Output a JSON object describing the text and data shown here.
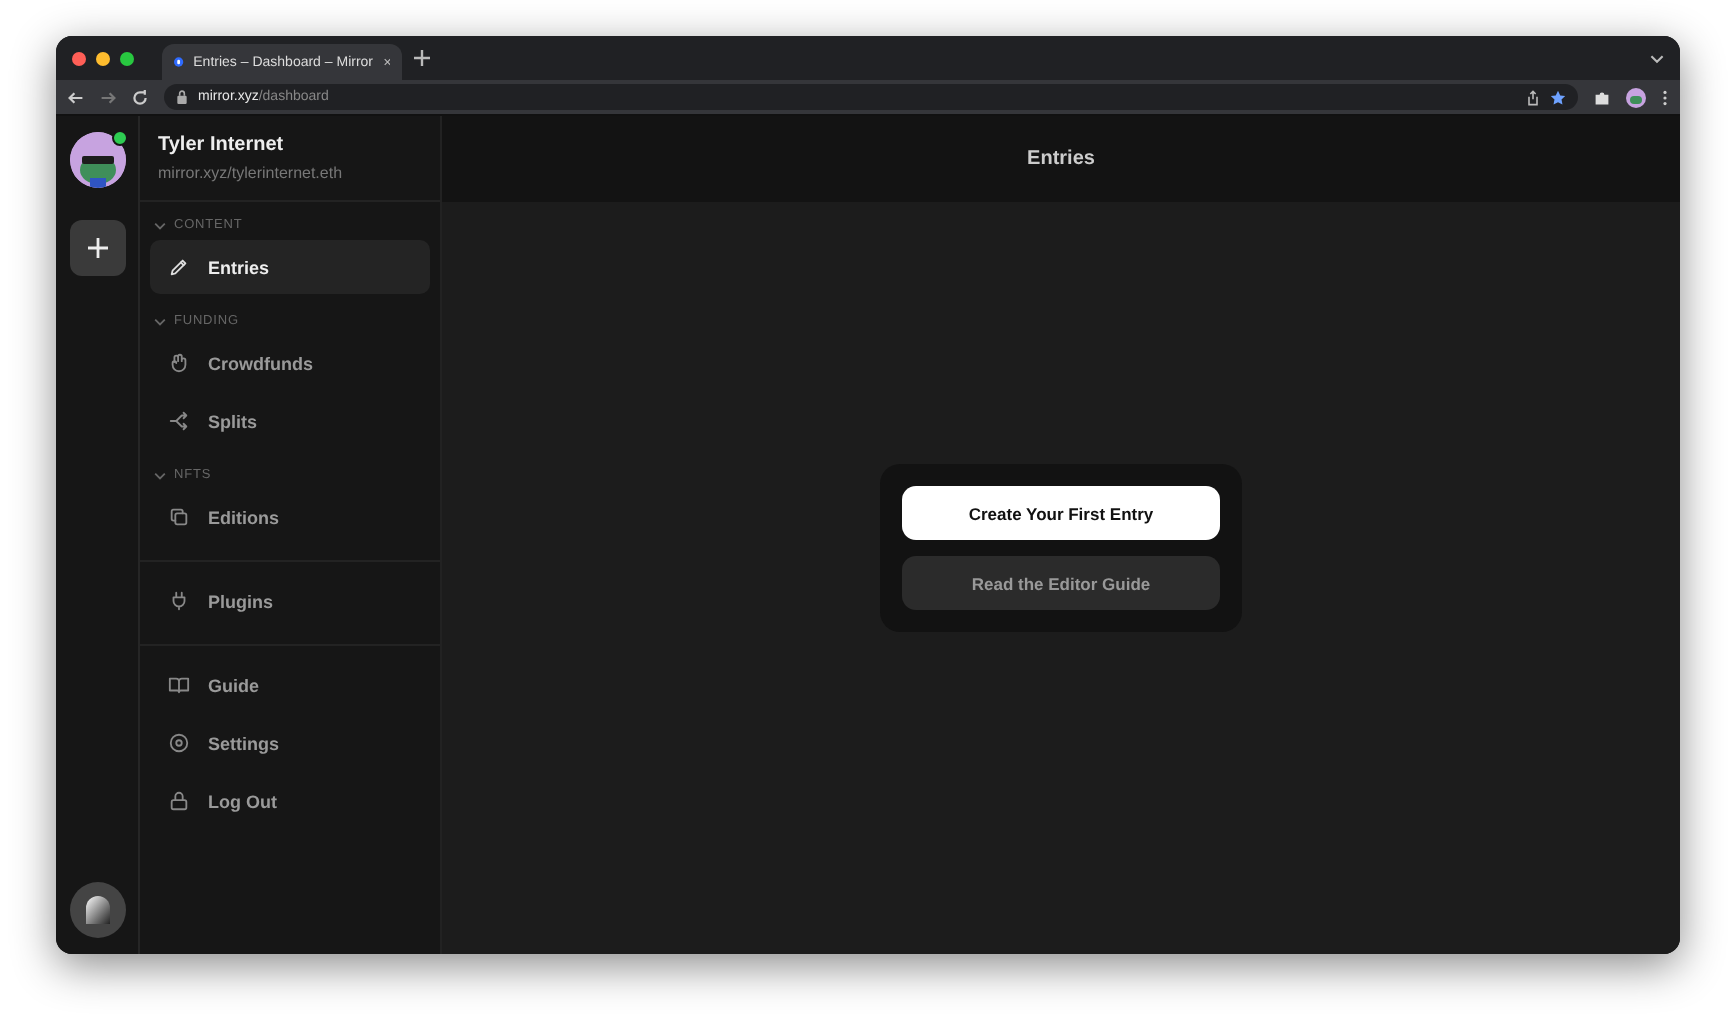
{
  "browser": {
    "tab_title": "Entries – Dashboard – Mirror",
    "url_host": "mirror.xyz",
    "url_path": "/dashboard",
    "bookmarked": true
  },
  "profile": {
    "name": "Tyler Internet",
    "address": "mirror.xyz/tylerinternet.eth",
    "online": true
  },
  "sidebar": {
    "groups": [
      {
        "heading": "CONTENT",
        "expanded": true,
        "items": [
          {
            "label": "Entries",
            "kind": "pencil",
            "selected": true
          }
        ]
      },
      {
        "heading": "FUNDING",
        "expanded": true,
        "items": [
          {
            "label": "Crowdfunds",
            "kind": "hand",
            "selected": false
          },
          {
            "label": "Splits",
            "kind": "split",
            "selected": false
          }
        ]
      },
      {
        "heading": "NFTS",
        "expanded": true,
        "items": [
          {
            "label": "Editions",
            "kind": "copies",
            "selected": false
          }
        ]
      },
      {
        "items": [
          {
            "label": "Plugins",
            "kind": "plug",
            "selected": false
          }
        ]
      },
      {
        "items": [
          {
            "label": "Guide",
            "kind": "book",
            "selected": false
          },
          {
            "label": "Settings",
            "kind": "gear",
            "selected": false
          },
          {
            "label": "Log Out",
            "kind": "lock",
            "selected": false
          }
        ]
      }
    ]
  },
  "main": {
    "title": "Entries",
    "buttons": [
      {
        "label": "Create Your First Entry",
        "kind": "primary"
      },
      {
        "label": "Read the Editor Guide",
        "kind": "secondary"
      }
    ]
  }
}
